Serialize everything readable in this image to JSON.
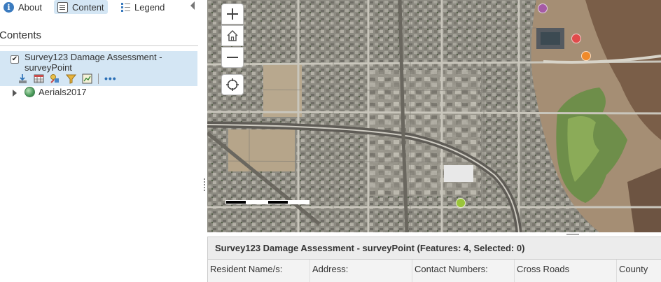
{
  "nav": {
    "tabs": [
      {
        "label": "About",
        "icon": "info-icon"
      },
      {
        "label": "Content",
        "icon": "content-icon",
        "active": true
      },
      {
        "label": "Legend",
        "icon": "legend-icon"
      }
    ]
  },
  "contents": {
    "title": "Contents",
    "layers": [
      {
        "label": "Survey123 Damage Assessment - surveyPoint",
        "checked": true
      },
      {
        "label": "Aerials2017",
        "expanded": false
      }
    ],
    "tools_more": "•••"
  },
  "map": {
    "points": [
      {
        "color": "#a55aa5"
      },
      {
        "color": "#e04b4b"
      },
      {
        "color": "#f08a2a"
      },
      {
        "color": "#9ac43a"
      }
    ]
  },
  "table": {
    "title": "Survey123 Damage Assessment - surveyPoint (Features: 4, Selected: 0)",
    "columns": [
      "Resident Name/s:",
      "Address:",
      "Contact Numbers:",
      "Cross Roads",
      "County"
    ]
  },
  "colors": {
    "active_tab": "#d4e6f4",
    "accent": "#2a6fb6"
  }
}
